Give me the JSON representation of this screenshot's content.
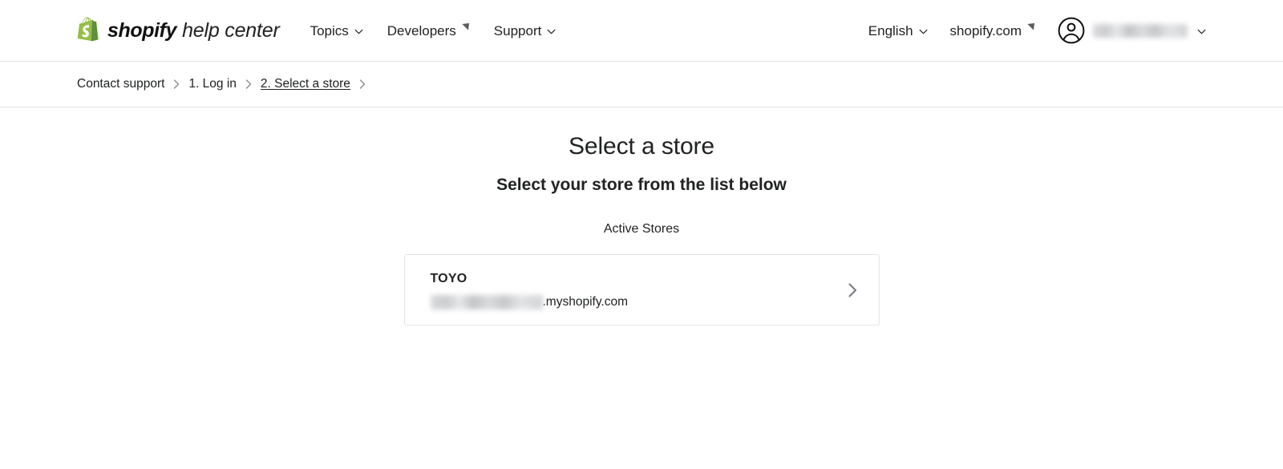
{
  "header": {
    "logo": {
      "mark": "shopify-bag-icon",
      "word": "shopify",
      "sub": "help center"
    },
    "nav": [
      {
        "label": "Topics",
        "icon": "chevron-down-icon",
        "name": "topics"
      },
      {
        "label": "Developers",
        "icon": "external-link-icon",
        "name": "developers"
      },
      {
        "label": "Support",
        "icon": "chevron-down-icon",
        "name": "support"
      }
    ],
    "right": [
      {
        "label": "English",
        "icon": "chevron-down-icon",
        "name": "language"
      },
      {
        "label": "shopify.com",
        "icon": "external-link-icon",
        "name": "shopify-com"
      }
    ],
    "account": {
      "avatar_icon": "account-circle-icon",
      "name": "",
      "name_redacted": true,
      "caret": "chevron-down-icon"
    }
  },
  "breadcrumb": {
    "separator_icon": "chevron-right-icon",
    "items": [
      {
        "label": "Contact support",
        "current": false
      },
      {
        "label": "1. Log in",
        "current": false
      },
      {
        "label": "2. Select a store",
        "current": true
      }
    ],
    "trailing_separator": true
  },
  "main": {
    "title": "Select a store",
    "subtitle": "Select your store from the list below",
    "section_label": "Active Stores",
    "stores": [
      {
        "name": "TOYO",
        "subdomain": "",
        "subdomain_redacted": true,
        "domain_suffix": ".myshopify.com",
        "chevron_icon": "chevron-right-icon"
      }
    ]
  },
  "colors": {
    "text": "#202223",
    "border": "#e1e3e5",
    "card_border": "#e3e4e6",
    "chevron": "#7c8187",
    "brand_green": "#95bf47",
    "brand_green_dark": "#5e8e3e",
    "background": "#ffffff"
  }
}
